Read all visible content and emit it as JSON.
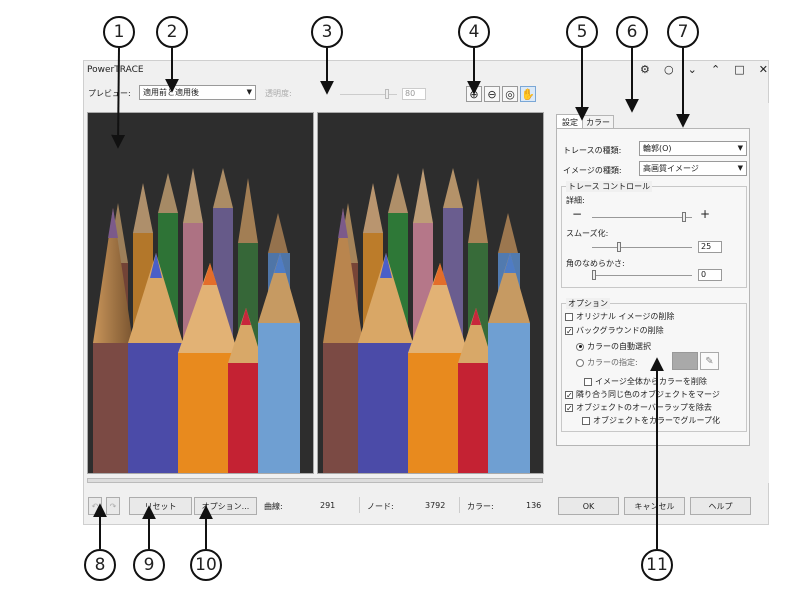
{
  "callouts": [
    "1",
    "2",
    "3",
    "4",
    "5",
    "6",
    "7",
    "8",
    "9",
    "10",
    "11"
  ],
  "window": {
    "title": "PowerTRACE",
    "controls": [
      "⚙",
      "○",
      "⌄",
      "⌃",
      "□",
      "✕"
    ]
  },
  "toolbar": {
    "preview_label": "プレビュー:",
    "preview_value": "適用前と適用後",
    "transparency_label": "透明度:",
    "transparency_value": "80"
  },
  "tabs": [
    "設定",
    "カラー"
  ],
  "settings": {
    "trace_type_label": "トレースの種類:",
    "trace_type_value": "輪郭(O)",
    "image_type_label": "イメージの種類:",
    "image_type_value": "高画質イメージ",
    "trace_controls_title": "トレース コントロール",
    "detail_label": "詳細:",
    "detail_minus": "−",
    "detail_plus": "+",
    "smoothing_label": "スムーズ化:",
    "smoothing_value": "25",
    "corner_label": "角のなめらかさ:",
    "corner_value": "0"
  },
  "options": {
    "title": "オプション",
    "remove_original": "オリジナル イメージの削除",
    "remove_background": "バックグラウンドの削除",
    "auto_color": "カラーの自動選択",
    "specify_color": "カラーの指定:",
    "specify_color_swatch": "#a9a9a9",
    "remove_from_whole": "イメージ全体からカラーを削除",
    "merge_adjacent": "隣り合う同じ色のオブジェクトをマージ",
    "remove_overlap": "オブジェクトのオーバーラップを除去",
    "group_by_color": "オブジェクトをカラーでグループ化"
  },
  "bottom": {
    "reset": "リセット",
    "options": "オプション...",
    "curves_label": "曲線:",
    "curves_value": "291",
    "nodes_label": "ノード:",
    "nodes_value": "3792",
    "colors_label": "カラー:",
    "colors_value": "136",
    "ok": "OK",
    "cancel": "キャンセル",
    "help": "ヘルプ"
  },
  "colors": {
    "dialog_bg": "#f0f0f0",
    "preview_bg": "#2a2a2a",
    "accent_hand": "#f5c542"
  }
}
